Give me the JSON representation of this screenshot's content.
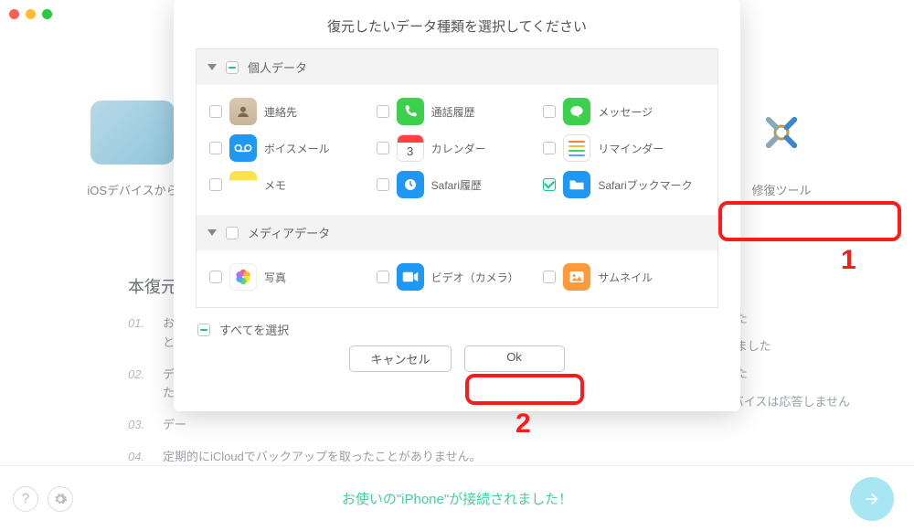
{
  "modal": {
    "title": "復元したいデータ種類を選択してください",
    "section_personal": "個人データ",
    "section_media": "メディアデータ",
    "items": {
      "contacts": "連絡先",
      "call_history": "通話履歴",
      "messages": "メッセージ",
      "voicemail": "ボイスメール",
      "calendar": "カレンダー",
      "calendar_day": "3",
      "reminders": "リマインダー",
      "notes": "メモ",
      "safari_history": "Safari履歴",
      "safari_bookmarks": "Safariブックマーク",
      "photos": "写真",
      "video": "ビデオ（カメラ）",
      "thumbnails": "サムネイル"
    },
    "select_all": "すべてを選択",
    "cancel": "キャンセル",
    "ok": "Ok"
  },
  "bg": {
    "cat_ios": "iOSデバイスから",
    "cat_repair": "修復ツール",
    "steps_title": "本復元・",
    "s01": "お使",
    "s01b": "とが",
    "s02": "デー",
    "s02b": "たは",
    "s03": "デー",
    "s04": "定期的にiCloudでバックアップを取ったことがありません。",
    "right1": "しました",
    "right2": "を忘れました",
    "right3": "しました",
    "device": "デバイスは応答しません"
  },
  "footer": {
    "status": "お使いの\"iPhone\"が接続されました！"
  },
  "annot": {
    "one": "1",
    "two": "2"
  }
}
